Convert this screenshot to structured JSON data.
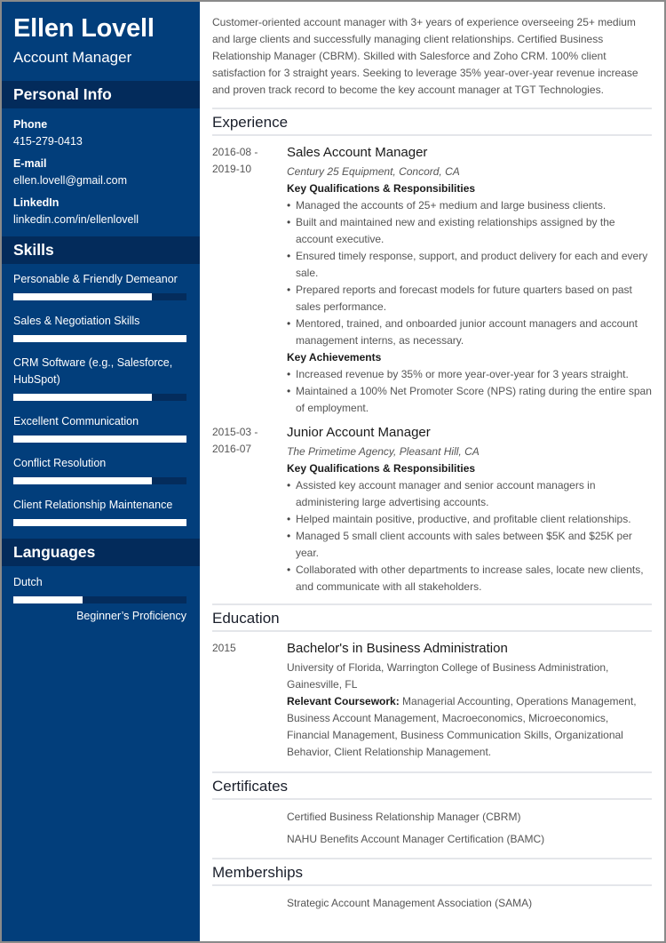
{
  "header": {
    "name": "Ellen Lovell",
    "title": "Account Manager"
  },
  "colors": {
    "sidebar": "#023e7b",
    "sidebar_section": "#032b5b",
    "bar_track": "#042c5c",
    "bar_fill": "#ffffff"
  },
  "personal_info": {
    "heading": "Personal Info",
    "items": [
      {
        "label": "Phone",
        "value": "415-279-0413"
      },
      {
        "label": "E-mail",
        "value": "ellen.lovell@gmail.com"
      },
      {
        "label": "LinkedIn",
        "value": "linkedin.com/in/ellenlovell"
      }
    ]
  },
  "skills": {
    "heading": "Skills",
    "items": [
      {
        "name": "Personable & Friendly Demeanor",
        "level": 0.8
      },
      {
        "name": "Sales & Negotiation Skills",
        "level": 1.0
      },
      {
        "name": "CRM Software (e.g., Salesforce, HubSpot)",
        "level": 0.8
      },
      {
        "name": "Excellent Communication",
        "level": 1.0
      },
      {
        "name": "Conflict Resolution",
        "level": 0.8
      },
      {
        "name": "Client Relationship Maintenance",
        "level": 1.0
      }
    ]
  },
  "languages": {
    "heading": "Languages",
    "items": [
      {
        "name": "Dutch",
        "level": 0.4,
        "label": "Beginner’s Proficiency"
      }
    ]
  },
  "summary": "Customer-oriented account manager with 3+ years of experience overseeing 25+ medium and large clients and successfully managing client relationships. Certified Business Relationship Manager (CBRM). Skilled with Salesforce and Zoho CRM. 100% client satisfaction for 3 straight years. Seeking to leverage 35% year-over-year revenue increase and proven track record to become the key account manager at TGT Technologies.",
  "experience": {
    "heading": "Experience",
    "jobs": [
      {
        "date_start": "2016-08 -",
        "date_end": "2019-10",
        "title": "Sales Account Manager",
        "company": "Century 25 Equipment, Concord, CA",
        "resp_heading": "Key Qualifications & Responsibilities",
        "responsibilities": [
          "Managed the accounts of 25+ medium and large business clients.",
          "Built and maintained new and existing relationships assigned by the account executive.",
          "Ensured timely response, support, and product delivery for each and every sale.",
          "Prepared reports and forecast models for future quarters based on past sales performance.",
          "Mentored, trained, and onboarded junior account managers and account management interns, as necessary."
        ],
        "ach_heading": "Key Achievements",
        "achievements": [
          "Increased revenue by 35% or more year-over-year for 3 years straight.",
          "Maintained a 100% Net Promoter Score (NPS) rating during the entire span of employment."
        ]
      },
      {
        "date_start": "2015-03 -",
        "date_end": "2016-07",
        "title": "Junior Account Manager",
        "company": "The Primetime Agency, Pleasant Hill, CA",
        "resp_heading": "Key Qualifications & Responsibilities",
        "responsibilities": [
          "Assisted key account manager and senior account managers in administering large advertising accounts.",
          "Helped maintain positive, productive, and profitable client relationships.",
          "Managed 5 small client accounts with sales between $5K and $25K per year.",
          "Collaborated with other departments to increase sales, locate new clients, and communicate with all stakeholders."
        ]
      }
    ]
  },
  "education": {
    "heading": "Education",
    "items": [
      {
        "date": "2015",
        "degree": "Bachelor's in Business Administration",
        "school": "University of Florida, Warrington College of Business Administration, Gainesville, FL",
        "coursework_label": "Relevant Coursework:",
        "coursework": " Managerial Accounting, Operations Management, Business Account Management, Macroeconomics, Microeconomics, Financial Management, Business Communication Skills, Organizational Behavior, Client Relationship Management."
      }
    ]
  },
  "certificates": {
    "heading": "Certificates",
    "items": [
      "Certified Business Relationship Manager (CBRM)",
      "NAHU Benefits Account Manager Certification (BAMC)"
    ]
  },
  "memberships": {
    "heading": "Memberships",
    "items": [
      "Strategic Account Management Association (SAMA)"
    ]
  }
}
